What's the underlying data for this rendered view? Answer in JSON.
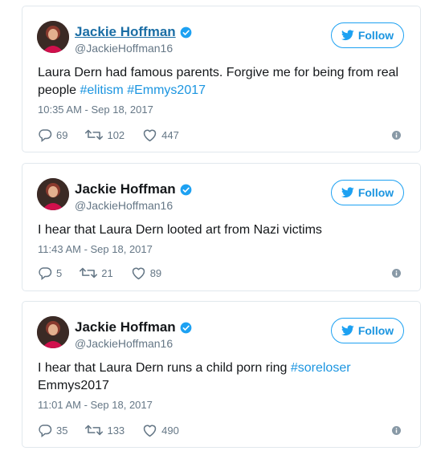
{
  "tweets": [
    {
      "name": "Jackie Hoffman",
      "handle": "@JackieHoffman16",
      "follow_label": "Follow",
      "text_parts": [
        "Laura Dern had famous parents. Forgive me for being from real people "
      ],
      "hashtags": [
        "#elitism",
        "#Emmys2017"
      ],
      "timestamp": "10:35 AM - Sep 18, 2017",
      "replies": "69",
      "retweets": "102",
      "likes": "447"
    },
    {
      "name": "Jackie Hoffman",
      "handle": "@JackieHoffman16",
      "follow_label": "Follow",
      "text": "I hear that Laura Dern looted art from Nazi victims",
      "timestamp": "11:43 AM - Sep 18, 2017",
      "replies": "5",
      "retweets": "21",
      "likes": "89"
    },
    {
      "name": "Jackie Hoffman",
      "handle": "@JackieHoffman16",
      "follow_label": "Follow",
      "text_parts": [
        "I hear that Laura Dern runs a child porn ring ",
        "Emmys2017"
      ],
      "hashtags": [
        "#soreloser"
      ],
      "timestamp": "11:01 AM - Sep 18, 2017",
      "replies": "35",
      "retweets": "133",
      "likes": "490"
    }
  ],
  "colors": {
    "link": "#1b95e0",
    "name_link": "#1b6ea5",
    "muted": "#657786",
    "border": "#e1e8ed",
    "verified": "#1da1f2"
  },
  "icons": {
    "avatar": "profile-photo",
    "verified": "verified-badge-icon",
    "follow": "twitter-bird-icon",
    "reply": "reply-bubble-icon",
    "retweet": "retweet-icon",
    "like": "heart-icon",
    "info": "info-circle-icon"
  }
}
